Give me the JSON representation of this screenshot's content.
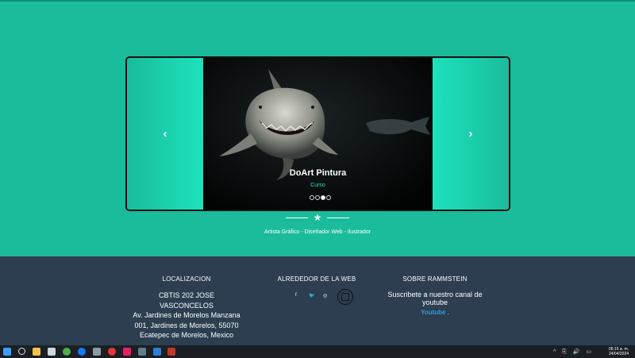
{
  "carousel": {
    "title": "DoArt Pintura",
    "subtitle": "Curso",
    "prev_symbol": "‹",
    "next_symbol": "›",
    "dots_total": 4,
    "active_dot": 3
  },
  "hero": {
    "tagline": "Artista Gráfico - Diseñador Web - Ilustrador",
    "star": "★"
  },
  "footer": {
    "location_title": "LOCALIZACION",
    "address": [
      "CBTIS 202 JOSE VASCONCELOS",
      "Av. Jardines de Morelos Manzana",
      "001, Jardines de Morelos, 55070",
      "Ecatepec de Morelos, Mexico"
    ],
    "web_title": "ALREDEDOR DE LA WEB",
    "social": {
      "facebook": "f",
      "twitter": "🐦",
      "dribbble": "◎"
    },
    "about_title": "SOBRE RAMMSTEIN",
    "about_text": "Suscribete a nuestro canal de youtube",
    "youtube_link": "Youtube",
    "youtube_suffix": " ."
  },
  "taskbar": {
    "time": "06:15 a. m.",
    "date": "24/04/2024",
    "tray_icons": "^ ⎘ 🔊 ▭"
  },
  "colors": {
    "hero_bg": "#1abc9c",
    "accent": "#1de6c0",
    "footer_bg": "#2c3e50",
    "link": "#3498db"
  }
}
